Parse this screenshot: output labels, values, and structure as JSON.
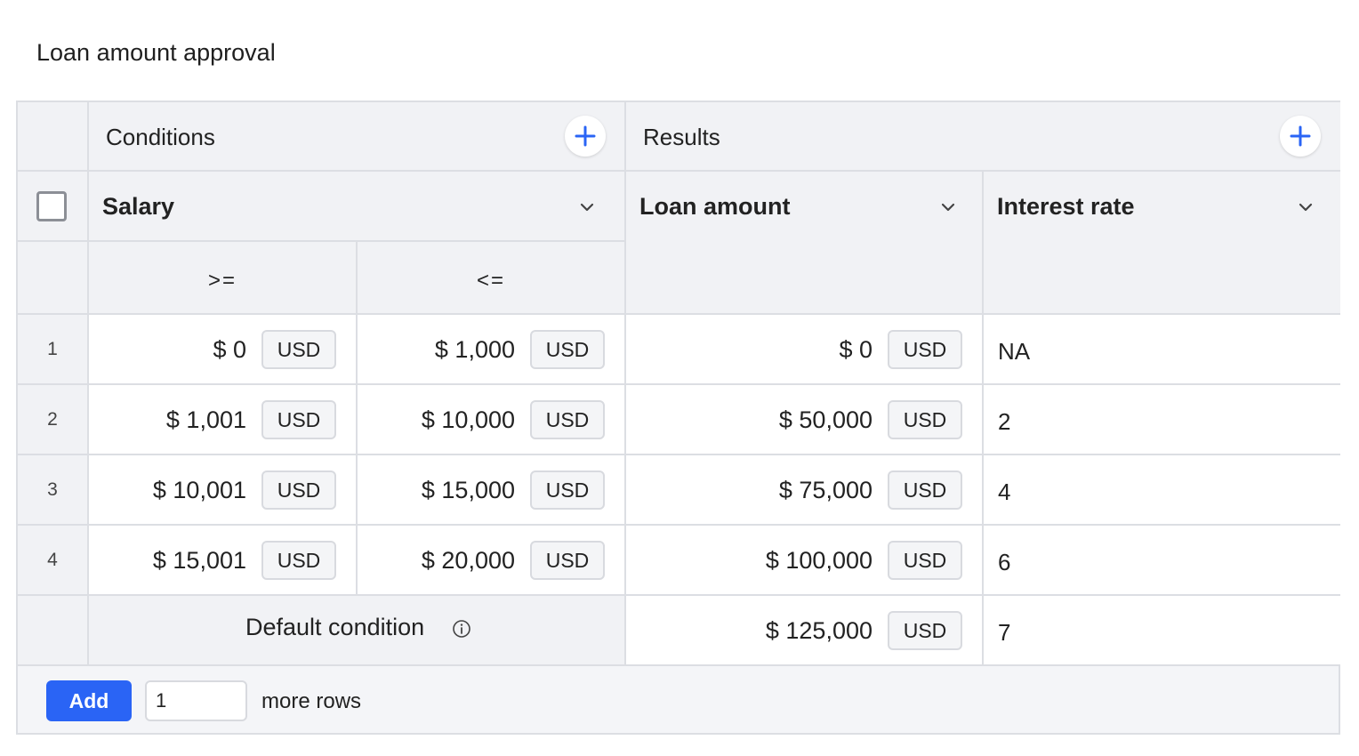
{
  "title": "Loan amount approval",
  "groups": {
    "conditions": "Conditions",
    "results": "Results"
  },
  "columns": {
    "salary": "Salary",
    "loan_amount": "Loan amount",
    "interest_rate": "Interest rate"
  },
  "operators": {
    "gte": ">=",
    "lte": "<="
  },
  "currency": "USD",
  "rows": [
    {
      "num": "1",
      "salary_min": "$ 0",
      "salary_max": "$ 1,000",
      "loan": "$ 0",
      "rate": "NA"
    },
    {
      "num": "2",
      "salary_min": "$ 1,001",
      "salary_max": "$ 10,000",
      "loan": "$ 50,000",
      "rate": "2"
    },
    {
      "num": "3",
      "salary_min": "$ 10,001",
      "salary_max": "$ 15,000",
      "loan": "$ 75,000",
      "rate": "4"
    },
    {
      "num": "4",
      "salary_min": "$ 15,001",
      "salary_max": "$ 20,000",
      "loan": "$ 100,000",
      "rate": "6"
    }
  ],
  "default_row": {
    "label": "Default condition",
    "loan": "$ 125,000",
    "rate": "7"
  },
  "footer": {
    "add_label": "Add",
    "rows_value": "1",
    "more_rows_label": "more rows"
  },
  "colors": {
    "accent": "#2a64f5",
    "header_bg": "#f1f2f5",
    "border": "#dcdee3"
  },
  "icons": {
    "add_condition": "plus-icon",
    "add_result": "plus-icon",
    "column_menu": "chevron-down-icon",
    "default_info": "info-icon"
  }
}
